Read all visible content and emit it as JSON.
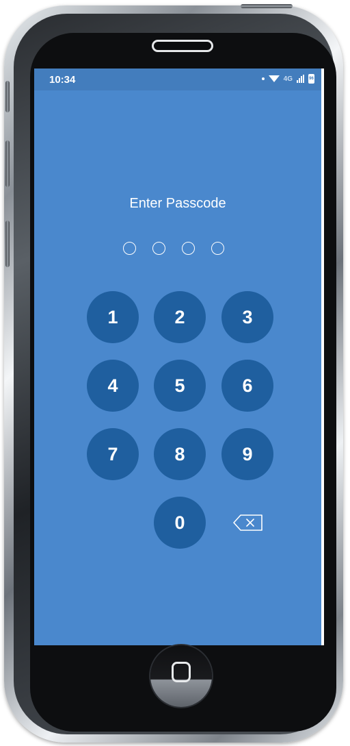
{
  "status_bar": {
    "time": "10:34",
    "network": "4G",
    "battery_level": "96"
  },
  "lock_screen": {
    "title": "Enter Passcode",
    "pin_length": 4
  },
  "keypad": {
    "keys": [
      "1",
      "2",
      "3",
      "4",
      "5",
      "6",
      "7",
      "8",
      "9",
      "0"
    ],
    "backspace_icon": "backspace-icon"
  },
  "colors": {
    "screen_background": "#4a88cd",
    "key_background": "#1f5f9f",
    "text": "#ffffff"
  }
}
